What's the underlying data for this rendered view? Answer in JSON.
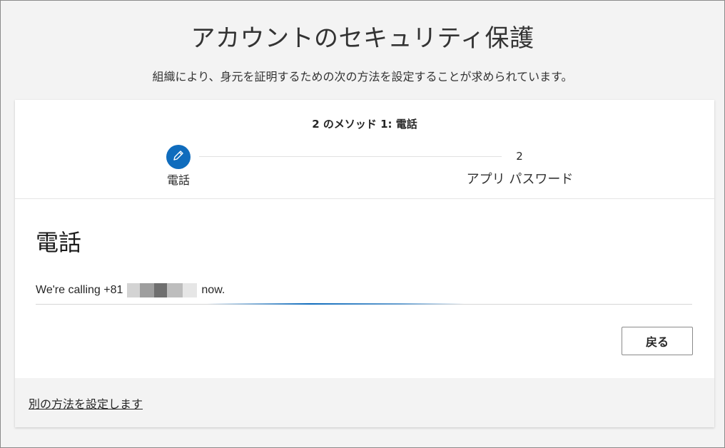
{
  "header": {
    "title": "アカウントのセキュリティ保護",
    "subtitle": "組織により、身元を証明するための次の方法を設定することが求められています。"
  },
  "wizard": {
    "counter": "2 のメソッド 1: 電話",
    "steps": [
      {
        "label": "電話",
        "icon": "pencil-icon",
        "state": "current"
      },
      {
        "number": "2",
        "label": "アプリ パスワード",
        "state": "pending"
      }
    ]
  },
  "main": {
    "section_title": "電話",
    "calling_prefix": "We're calling +81",
    "calling_suffix": "now.",
    "progress_state": "indeterminate",
    "back_label": "戻る"
  },
  "footer": {
    "alt_method_link": "別の方法を設定します"
  },
  "colors": {
    "accent": "#0f6cbd",
    "page_background": "#f3f3f3",
    "card_background": "#ffffff"
  }
}
